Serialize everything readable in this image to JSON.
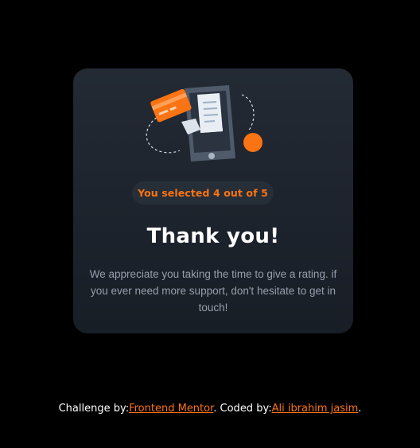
{
  "card": {
    "badge_text": "You selected 4 out of 5",
    "title": "Thank you!",
    "message": "We appreciate you taking the time to give a rating. if you ever need more support, don't hesitate to get in touch!",
    "illustration_icon": "phone-receipt-illustration"
  },
  "footer": {
    "prefix": "Challenge by:",
    "challenge_link": "Frontend Mentor",
    "middle": ". Coded by:",
    "author_link": "Ali ibrahim jasim",
    "suffix": "."
  },
  "colors": {
    "background": "#000000",
    "card_top": "#232a34",
    "card_bottom": "#181e26",
    "accent": "#fb7413",
    "badge_bg": "#262e38",
    "muted_text": "#969fad",
    "white": "#ffffff"
  }
}
